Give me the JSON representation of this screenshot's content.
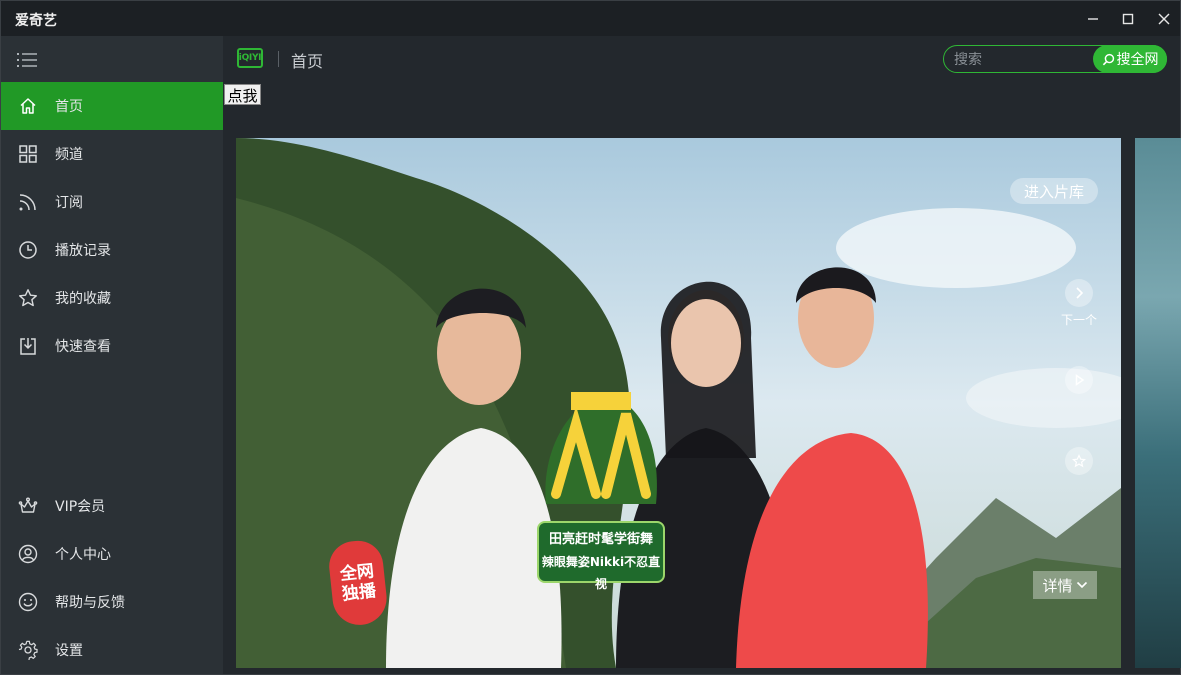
{
  "window": {
    "title": "爱奇艺"
  },
  "sidebar": {
    "items_top": [
      {
        "label": "首页",
        "icon": "home-icon",
        "active": true
      },
      {
        "label": "频道",
        "icon": "grid-icon"
      },
      {
        "label": "订阅",
        "icon": "rss-icon"
      },
      {
        "label": "播放记录",
        "icon": "clock-icon"
      },
      {
        "label": "我的收藏",
        "icon": "star-icon"
      },
      {
        "label": "快速查看",
        "icon": "download-icon"
      }
    ],
    "items_bottom": [
      {
        "label": "VIP会员",
        "icon": "crown-icon"
      },
      {
        "label": "个人中心",
        "icon": "user-icon"
      },
      {
        "label": "帮助与反馈",
        "icon": "smile-icon"
      },
      {
        "label": "设置",
        "icon": "gear-icon"
      }
    ]
  },
  "header": {
    "logo_text": "iQIYI",
    "page_title": "首页",
    "search_placeholder": "搜索",
    "search_button": "搜全网"
  },
  "click_button": "点我",
  "banner": {
    "library_button": "进入片库",
    "next_label": "下一个",
    "detail_button": "详情",
    "live_badge": [
      "全网",
      "独播"
    ],
    "show_caption": [
      "田亮赶时髦学街舞",
      "辣眼舞姿Nikki不忍直视"
    ]
  },
  "colors": {
    "accent": "#219926",
    "brand_green": "#2fb735",
    "sidebar_bg": "#2b3136",
    "header_bg": "#23282d"
  }
}
